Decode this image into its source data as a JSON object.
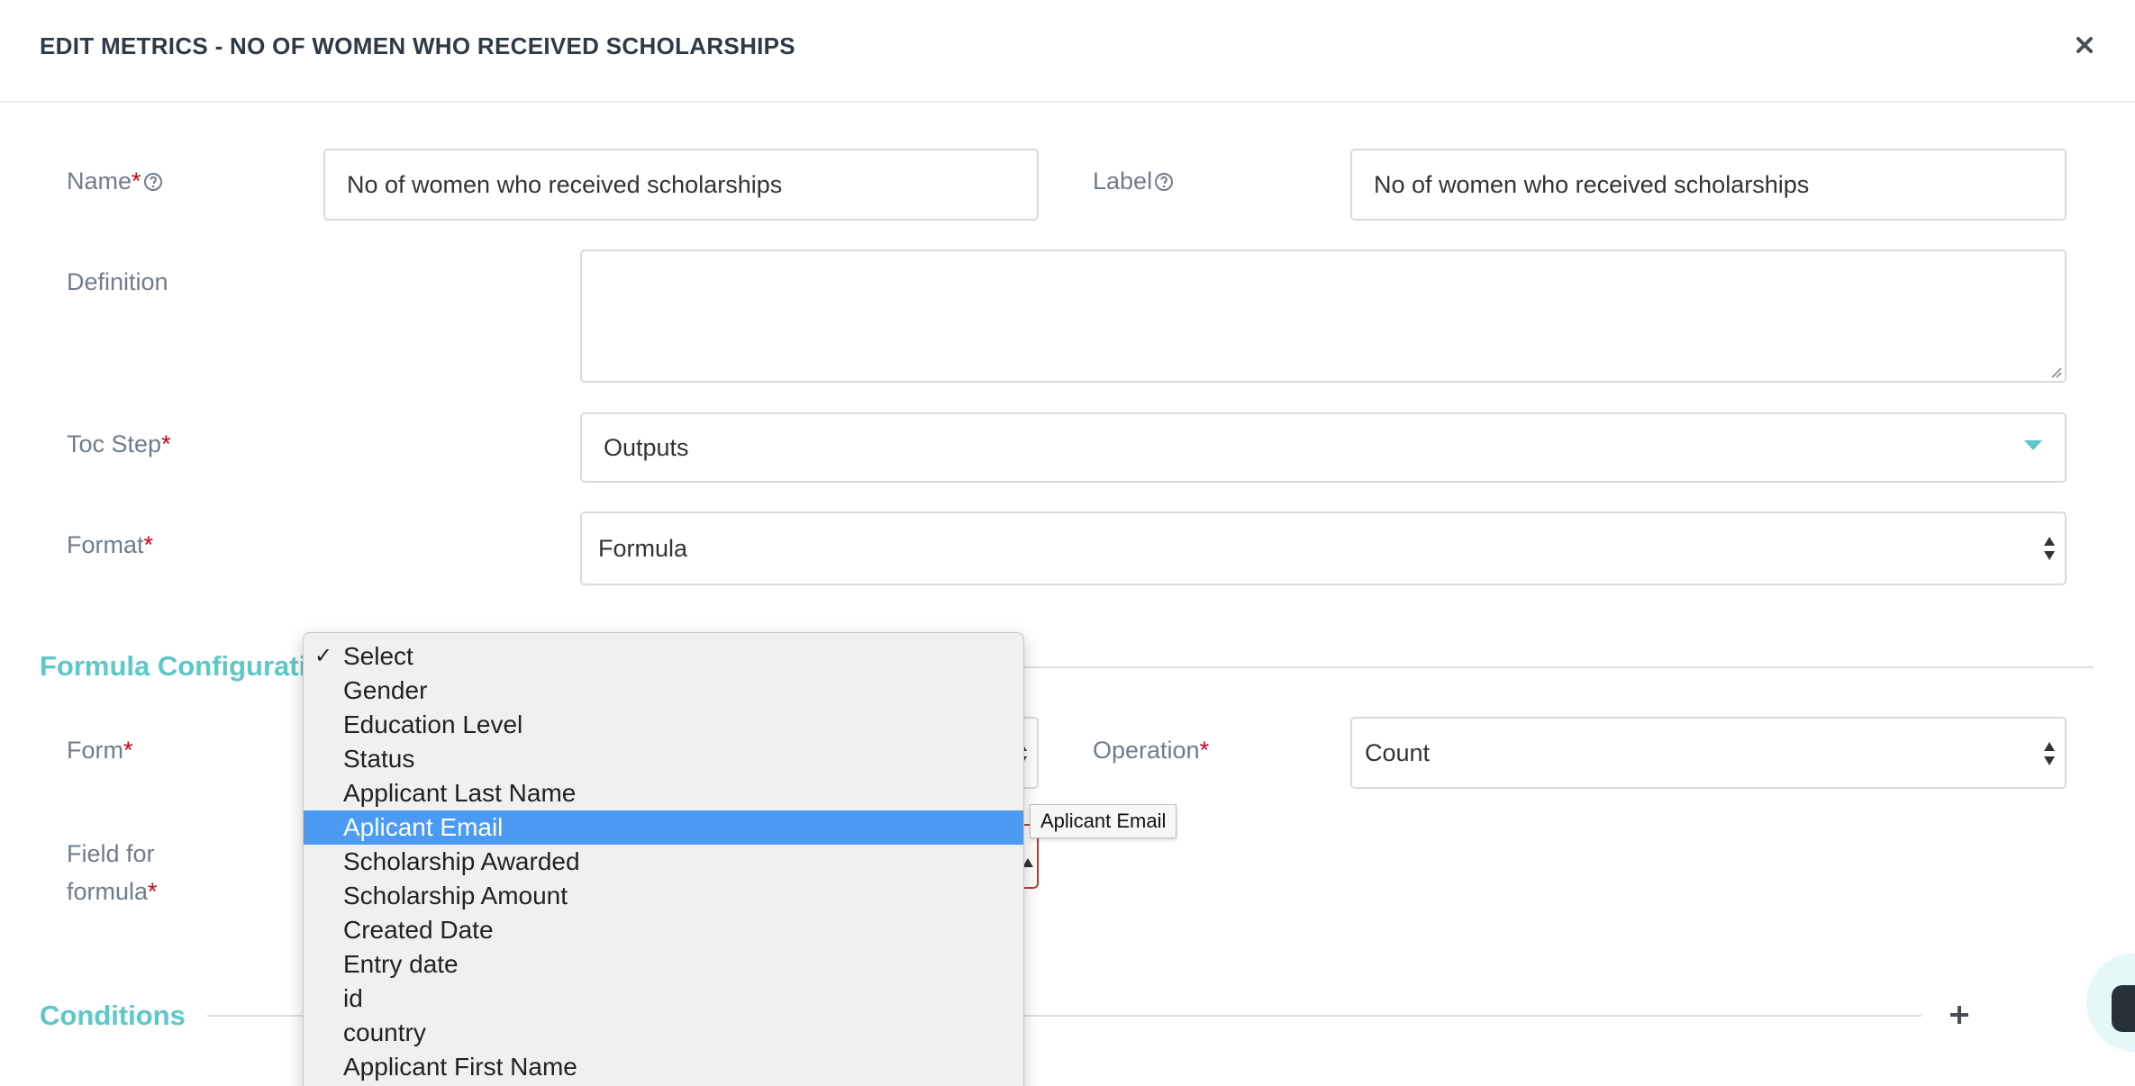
{
  "header": {
    "title": "EDIT METRICS - NO OF WOMEN WHO RECEIVED SCHOLARSHIPS"
  },
  "fields": {
    "name": {
      "label": "Name",
      "required_mark": "*",
      "value": "No of women who received scholarships"
    },
    "label": {
      "label": "Label",
      "value": "No of women who received scholarships"
    },
    "definition": {
      "label": "Definition",
      "value": ""
    },
    "toc_step": {
      "label": "Toc Step",
      "required_mark": "*",
      "value": "Outputs"
    },
    "format": {
      "label": "Format",
      "required_mark": "*",
      "value": "Formula"
    }
  },
  "formula_configuration": {
    "title": "Formula Configuratio",
    "form": {
      "label": "Form",
      "required_mark": "*"
    },
    "operation": {
      "label": "Operation",
      "required_mark": "*",
      "value": "Count"
    },
    "field_for_formula": {
      "label_line1": "Field for",
      "label_line2": "formula",
      "required_mark": "*"
    }
  },
  "conditions": {
    "title": "Conditions"
  },
  "dropdown": {
    "checked_mark": "✓",
    "options": [
      "Select",
      "Gender",
      "Education Level",
      "Status",
      "Applicant Last Name",
      "Aplicant Email",
      "Scholarship Awarded",
      "Scholarship Amount",
      "Created Date",
      "Entry date",
      "id",
      "country",
      "Applicant First Name"
    ],
    "selected": "Select",
    "highlighted": "Aplicant Email",
    "tooltip": "Aplicant Email"
  },
  "colors": {
    "accent": "#5ec7c7",
    "required": "#d0021b",
    "highlight": "#4b9af3",
    "error_border": "#c43a3a"
  },
  "icons": {
    "close": "close-icon",
    "help": "help-circle-icon",
    "caret": "caret-down-icon",
    "updown": "select-arrows-icon",
    "plus": "plus-icon",
    "check": "checkmark-icon",
    "chat": "chat-icon"
  }
}
